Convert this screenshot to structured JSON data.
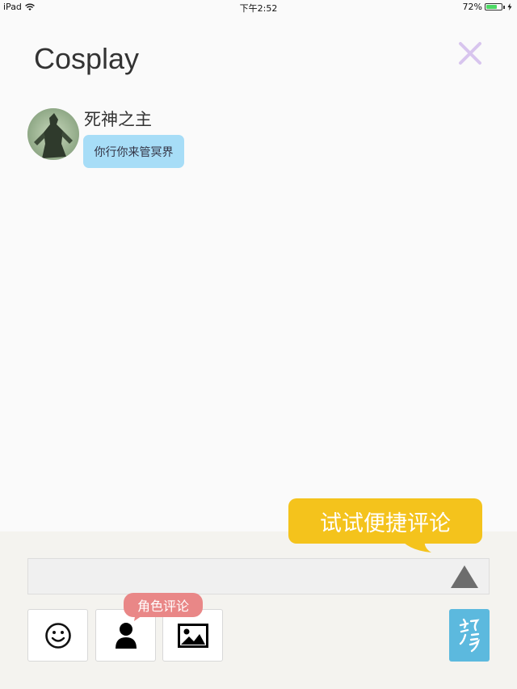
{
  "status_bar": {
    "device": "iPad",
    "time": "下午2:52",
    "battery_percent": "72%",
    "battery_level": 0.72
  },
  "header": {
    "title": "Cosplay"
  },
  "message": {
    "username": "死神之主",
    "text": "你行你来管冥界"
  },
  "tooltips": {
    "quick_comment": "试试便捷评论",
    "role_comment": "角色评论"
  },
  "colors": {
    "close_icon": "#d8c5ee",
    "bubble": "#a7ddf7",
    "quick_tooltip": "#f4c31c",
    "role_tooltip": "#e98787",
    "char_button": "#5cb9de"
  },
  "icons": {
    "close": "close-icon",
    "send": "send-triangle-icon",
    "emoji": "smiley-icon",
    "character": "person-icon",
    "image": "image-icon",
    "char_switch": "character-glyph-icon"
  }
}
